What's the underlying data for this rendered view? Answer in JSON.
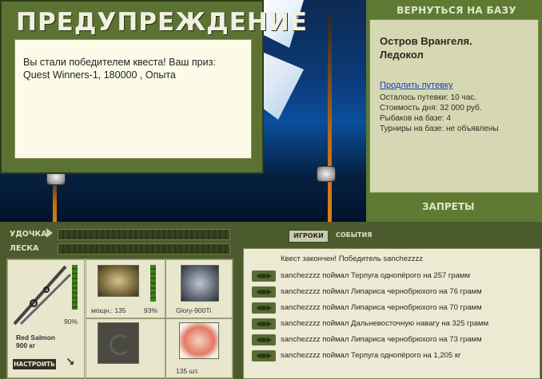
{
  "dialog": {
    "title": "ПРЕДУПРЕЖДЕНИЕ",
    "message": "Вы стали победителем квеста! Ваш приз: Quest Winners-1, 180000 , Опыта"
  },
  "right_panel": {
    "back_button": "ВЕРНУТЬСЯ НА БАЗУ",
    "base_name_line1": "Остров Врангеля.",
    "base_name_line2": "Ледокол",
    "extend_link": "Продлить путевку",
    "info": [
      "Осталось путевки: 10 час.",
      "Стоимость дня: 32 000 руб.",
      "Рыбаков на базе: 4",
      "Турниры на базе: не объявлены"
    ],
    "bans_button": "ЗАПРЕТЫ"
  },
  "meters": {
    "rod_label": "УДОЧКА",
    "line_label": "ЛЕСКА"
  },
  "tackle": {
    "rod_name": "Red Salmon",
    "rod_weight": "900 кг",
    "rod_condition": "90%",
    "reel_power": "мощн.: 135",
    "reel_condition": "93%",
    "line_name": "Glory-900Ti",
    "bait_count": "135 шт.",
    "adjust_button": "НАСТРОИТЬ"
  },
  "log_panel": {
    "tab_players": "ИГРОКИ",
    "tab_events": "СОБЫТИЯ",
    "header_msg": "Квест закончен! Победитель sanchezzzz",
    "messages": [
      "sanchezzzz поймал Терпуга однопёрого на 257 грамм",
      "sanchezzzz поймал Липариса чернобрюхого на 76 грамм",
      "sanchezzzz поймал Липариса чернобрюхого на 70 грамм",
      "sanchezzzz поймал Дальневосточную навагу на 325 грамм",
      "sanchezzzz поймал Липариса чернобрюхого на 73 грамм",
      "sanchezzzz поймал Терпуга однопёрого на 1,205 кг"
    ]
  }
}
